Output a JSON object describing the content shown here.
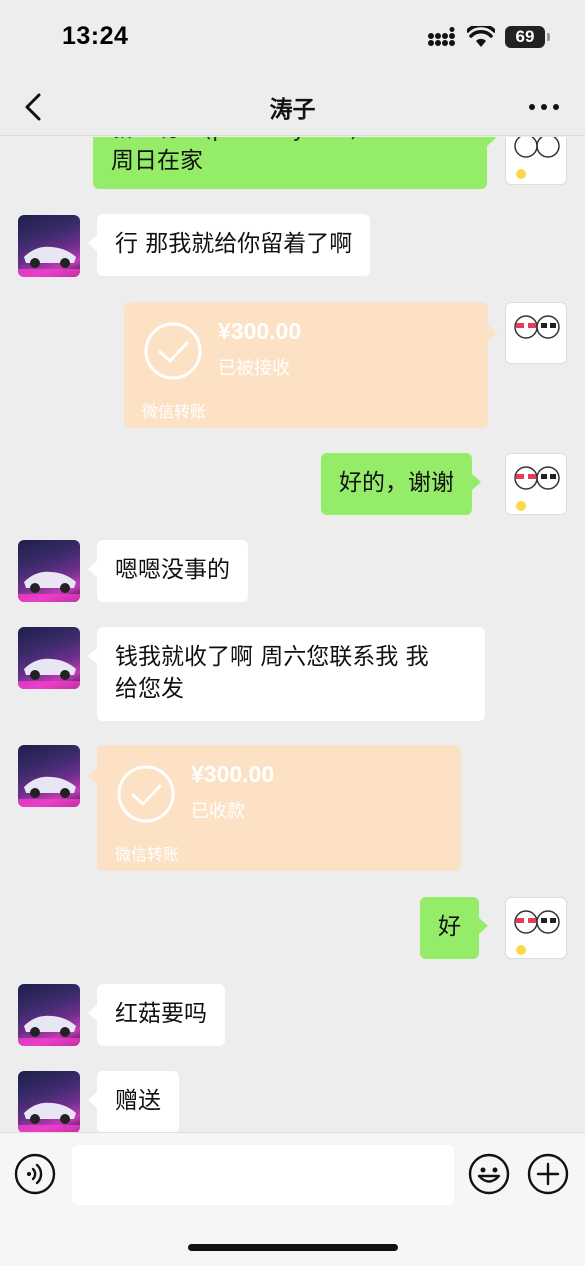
{
  "status_bar": {
    "time": "13:24",
    "battery": "69"
  },
  "nav": {
    "title": "涛子",
    "back_icon": "chevron-left-icon",
    "more_icon": "more-dots-icon"
  },
  "messages": [
    {
      "side": "right",
      "type": "text",
      "text_line1": "新…有…(partially cut)…",
      "text_line2": "周日在家"
    },
    {
      "side": "left",
      "type": "text",
      "text": "行 那我就给你留着了啊"
    },
    {
      "side": "right",
      "type": "transfer",
      "amount": "¥300.00",
      "status": "已被接收",
      "label": "微信转账"
    },
    {
      "side": "right",
      "type": "text",
      "text": "好的，谢谢"
    },
    {
      "side": "left",
      "type": "text",
      "text": "嗯嗯没事的"
    },
    {
      "side": "left",
      "type": "text",
      "text_line1": "钱我就收了啊 周六您联系我 我",
      "text_line2": "给您发"
    },
    {
      "side": "left",
      "type": "transfer",
      "amount": "¥300.00",
      "status": "已收款",
      "label": "微信转账"
    },
    {
      "side": "right",
      "type": "text",
      "text": "好"
    },
    {
      "side": "left",
      "type": "text",
      "text": "红菇要吗"
    },
    {
      "side": "left",
      "type": "text",
      "text": "赠送"
    }
  ],
  "input_bar": {
    "voice_icon": "voice-icon",
    "emoji_icon": "emoji-icon",
    "plus_icon": "plus-icon",
    "placeholder": ""
  },
  "colors": {
    "background": "#ededed",
    "bubble_me": "#95ec69",
    "bubble_other": "#ffffff",
    "transfer": "#fde1c4"
  }
}
